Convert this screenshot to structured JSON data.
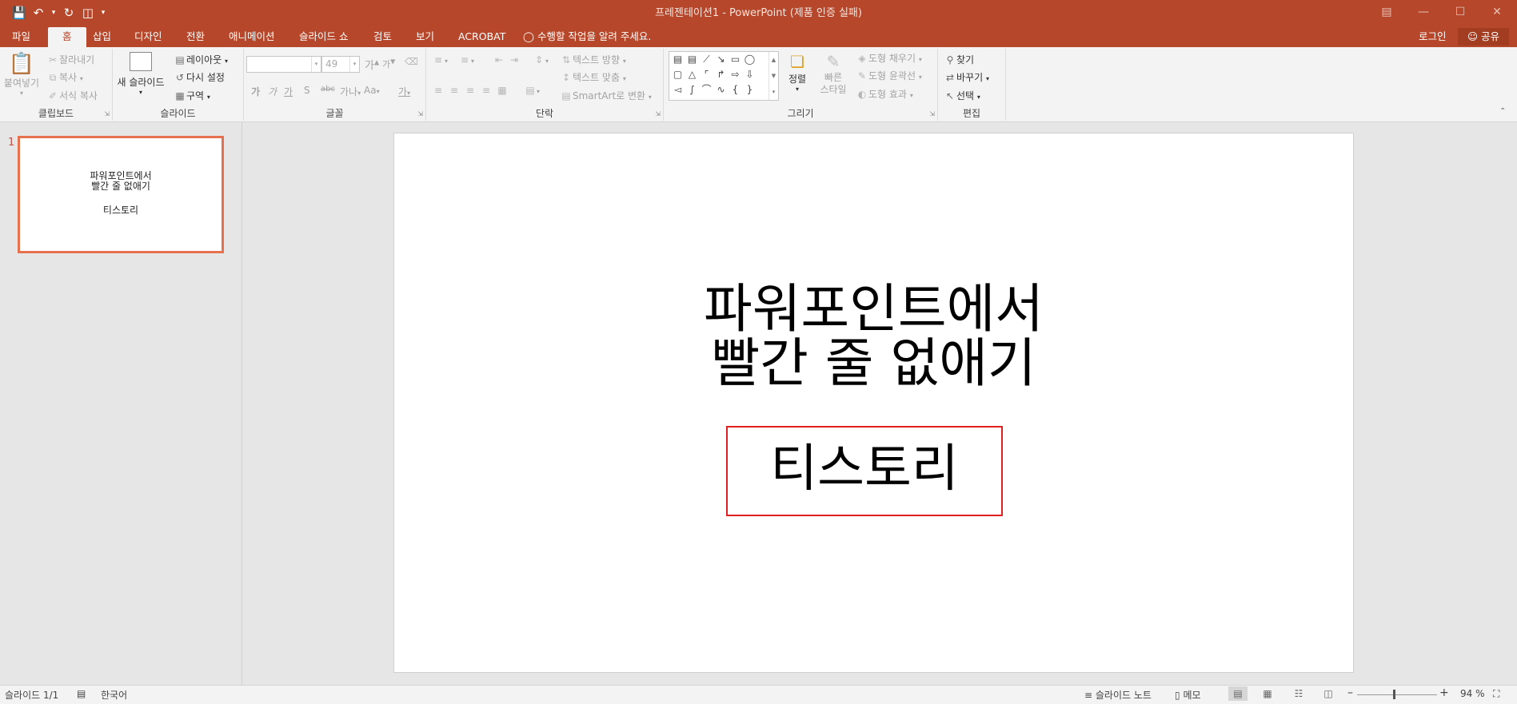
{
  "title_bar": {
    "document_title": "프레젠테이션1 - PowerPoint (제품 인증 실패)",
    "qat": {
      "save_icon": "save-icon",
      "undo_icon": "undo-icon",
      "redo_icon": "redo-icon",
      "start_presentation_icon": "presentation-icon"
    },
    "window_controls": [
      "ribbon-display-options",
      "minimize",
      "maximize",
      "close"
    ]
  },
  "tabs": [
    "파일",
    "홈",
    "삽입",
    "디자인",
    "전환",
    "애니메이션",
    "슬라이드 쇼",
    "검토",
    "보기",
    "ACROBAT"
  ],
  "active_tab": "홈",
  "tell_me": "수행할 작업을 알려 주세요.",
  "login": "로그인",
  "share": "공유",
  "ribbon": {
    "clipboard": {
      "label": "클립보드",
      "paste": "붙여넣기",
      "cut": "잘라내기",
      "copy": "복사",
      "format_painter": "서식 복사"
    },
    "slides": {
      "label": "슬라이드",
      "new_slide": "새 슬라이드",
      "layout": "레이아웃",
      "reset": "다시 설정",
      "section": "구역"
    },
    "font": {
      "label": "글꼴",
      "font_name": "",
      "font_size": "49",
      "increase": "가",
      "decrease": "가",
      "bold": "가",
      "italic": "가",
      "underline": "가",
      "shadow": "S",
      "strike": "abc",
      "spacing": "가나",
      "case": "Aa",
      "color": "가"
    },
    "paragraph": {
      "label": "단락",
      "text_direction": "텍스트 방향",
      "align_text": "텍스트 맞춤",
      "smartart": "SmartArt로 변환"
    },
    "drawing": {
      "label": "그리기",
      "arrange": "정렬",
      "quick_styles": "빠른\n스타일",
      "shape_fill": "도형 채우기",
      "shape_outline": "도형 윤곽선",
      "shape_effects": "도형 효과"
    },
    "editing": {
      "label": "편집",
      "find": "찾기",
      "replace": "바꾸기",
      "select": "선택"
    }
  },
  "thumbnails": [
    {
      "number": "1",
      "title": "파워포인트에서\n빨간 줄 없애기",
      "subtitle": "티스토리"
    }
  ],
  "slide": {
    "title": "파워포인트에서\n빨간 줄 없애기",
    "subtitle": "티스토리",
    "subtitle_border_color": "#e02020"
  },
  "status_bar": {
    "slide_counter": "슬라이드 1/1",
    "language": "한국어",
    "notes": "슬라이드 노트",
    "comments": "메모",
    "zoom": "94 %"
  },
  "colors": {
    "accent": "#b7472a",
    "thumbnail_selection": "#e5714f"
  }
}
